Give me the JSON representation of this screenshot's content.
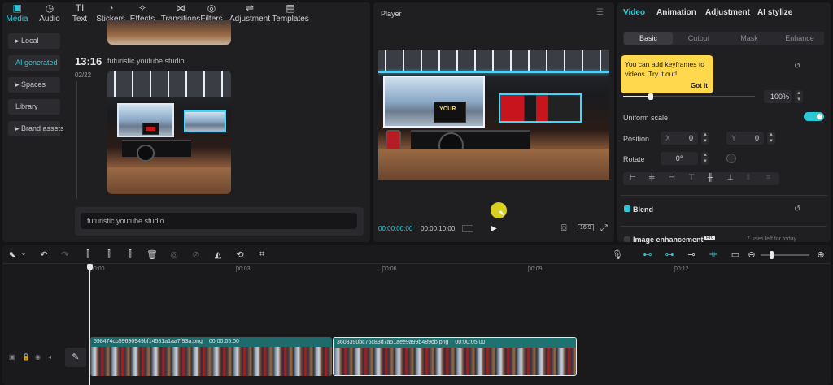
{
  "toolbar": {
    "items": [
      {
        "label": "Media",
        "icon": "media-icon",
        "glyph": "▣",
        "active": true
      },
      {
        "label": "Audio",
        "icon": "audio-icon",
        "glyph": "◷"
      },
      {
        "label": "Text",
        "icon": "text-icon",
        "glyph": "TI"
      },
      {
        "label": "Stickers",
        "icon": "stickers-icon",
        "glyph": "◔"
      },
      {
        "label": "Effects",
        "icon": "effects-icon",
        "glyph": "✧"
      },
      {
        "label": "Transitions",
        "icon": "transitions-icon",
        "glyph": "⋈"
      },
      {
        "label": "Filters",
        "icon": "filters-icon",
        "glyph": "◎"
      },
      {
        "label": "Adjustment",
        "icon": "adjustment-icon",
        "glyph": "⇌"
      },
      {
        "label": "Templates",
        "icon": "templates-icon",
        "glyph": "▤"
      }
    ]
  },
  "sidebar": {
    "items": [
      {
        "label": "▸ Local"
      },
      {
        "label": "AI generated",
        "active": true
      },
      {
        "label": "▸ Spaces"
      },
      {
        "label": "Library"
      },
      {
        "label": "▸ Brand assets"
      }
    ]
  },
  "media": {
    "time": "13:16",
    "prompt": "futuristic youtube studio",
    "date": "02/22",
    "input_value": "futuristic youtube studio"
  },
  "player": {
    "title": "Player",
    "menu_glyph": "☰",
    "current_time": "00:00:00:00",
    "duration": "00:00:10:00",
    "play_glyph": "▶",
    "ratio": "16:9",
    "fullscreen_glyph": "⤢",
    "fit_glyph": "⌼",
    "tv_text": "YOUR"
  },
  "inspector": {
    "tabs": [
      "Video",
      "Animation",
      "Adjustment",
      "AI stylize"
    ],
    "subtabs": [
      "Basic",
      "Cutout",
      "Mask",
      "Enhance"
    ],
    "tooltip": {
      "text": "You can add keyframes to videos. Try it out!",
      "button": "Got it"
    },
    "scale_value": "100%",
    "uniform_scale": "Uniform scale",
    "position_label": "Position",
    "x_label": "X",
    "x_value": "0",
    "y_label": "Y",
    "y_value": "0",
    "rotate_label": "Rotate",
    "rotate_value": "0°",
    "blend_label": "Blend",
    "image_enhancement": "Image enhancement",
    "pro_badge": "Pro",
    "uses_left": "7 uses left for today",
    "align_glyphs": [
      "⊢",
      "╪",
      "⊣",
      "⊤",
      "╫",
      "⊥",
      "⫴",
      "≡"
    ]
  },
  "timeline": {
    "ticks": [
      "00:00",
      "00:03",
      "00:06",
      "00:09",
      "00:12"
    ],
    "clips": [
      {
        "name": "598474cb59690949bf14581a1aa7f93a.png",
        "duration": "00:00:05:00"
      },
      {
        "name": "3603390bc76c83d7a51aee9a99b489db.png",
        "duration": "00:00:05:00"
      }
    ]
  },
  "colors": {
    "accent": "#28c8d8",
    "clip1": "#1f6b6b",
    "clip2": "#1e7270",
    "tooltip": "#ffd84d",
    "cursor": "#d8d020"
  }
}
